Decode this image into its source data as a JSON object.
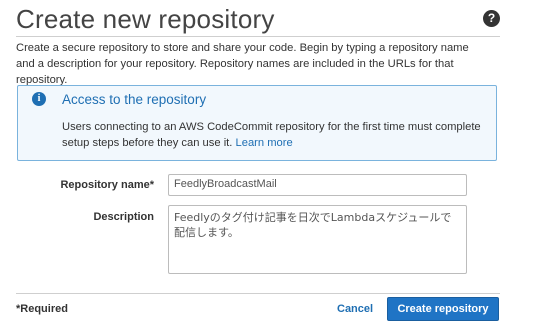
{
  "header": {
    "title": "Create new repository",
    "help_icon": "?"
  },
  "intro_text": "Create a secure repository to store and share your code. Begin by typing a repository name and a description for your repository. Repository names are included in the URLs for that repository.",
  "info_box": {
    "icon": "i",
    "title": "Access to the repository",
    "text": "Users connecting to an AWS CodeCommit repository for the first time must complete setup steps before they can use it. ",
    "link": "Learn more"
  },
  "form": {
    "repo_name_label": "Repository name*",
    "repo_name_value": "FeedlyBroadcastMail",
    "description_label": "Description",
    "description_value": "Feedlyのタグ付け記事を日次でLambdaスケジュールで配信します。"
  },
  "footer": {
    "required_note": "*Required",
    "cancel_label": "Cancel",
    "create_label": "Create repository"
  },
  "colors": {
    "accent": "#1f6fb3",
    "info_bg": "#f2f8fd",
    "info_border": "#7ab3dd",
    "primary_button": "#1f74c5"
  }
}
